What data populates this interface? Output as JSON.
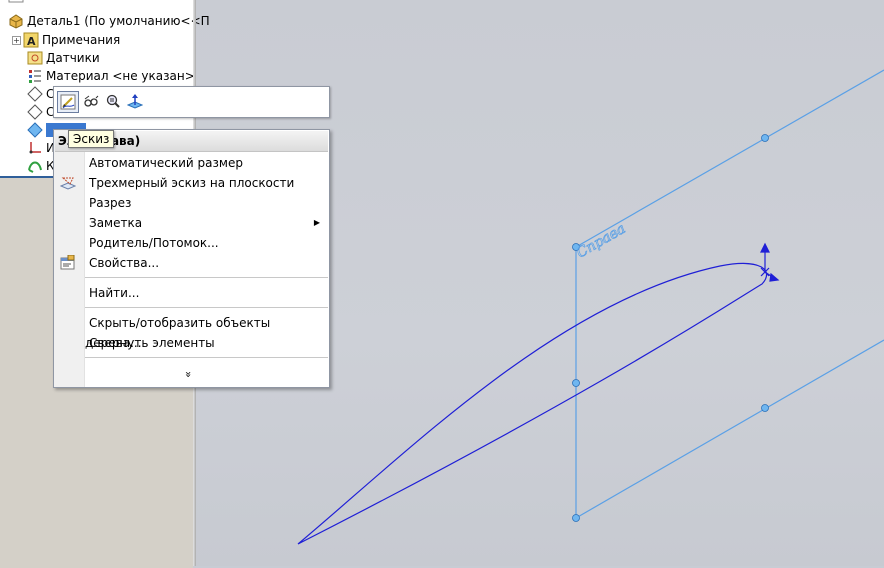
{
  "tree": {
    "part": "Деталь1  (По умолчанию<<П",
    "items": [
      {
        "label": "Примечания",
        "icon": "annotations-icon",
        "expandable": true
      },
      {
        "label": "Датчики",
        "icon": "sensors-icon"
      },
      {
        "label": "Материал <не указан>",
        "icon": "material-icon"
      },
      {
        "label": "С",
        "icon": "plane-icon"
      },
      {
        "label": "С",
        "icon": "plane-icon"
      },
      {
        "label": "",
        "icon": "plane-selected-icon"
      },
      {
        "label": "И",
        "icon": "origin-icon"
      },
      {
        "label": "К",
        "icon": "curve-icon"
      }
    ]
  },
  "tooltip": "Эскиз",
  "menu": {
    "header": "Эл        (Справа)",
    "items": [
      {
        "label": "Автоматический размер"
      },
      {
        "label": "Трехмерный эскиз на плоскости",
        "icon": "3d-sketch-on-plane-icon"
      },
      {
        "label": "Разрез"
      },
      {
        "label": "Заметка",
        "submenu": true
      },
      {
        "label": "Родитель/Потомок..."
      },
      {
        "label": "Свойства...",
        "icon": "properties-icon"
      },
      {
        "label": "Найти..."
      },
      {
        "label": "Скрыть/отобразить объекты дерева..."
      },
      {
        "label": "Свернуть элементы"
      }
    ],
    "more": "»"
  },
  "viewport": {
    "plane_label": "Справа",
    "plane_color": "#5aa0e6",
    "curve_color": "#1f1fd6"
  }
}
